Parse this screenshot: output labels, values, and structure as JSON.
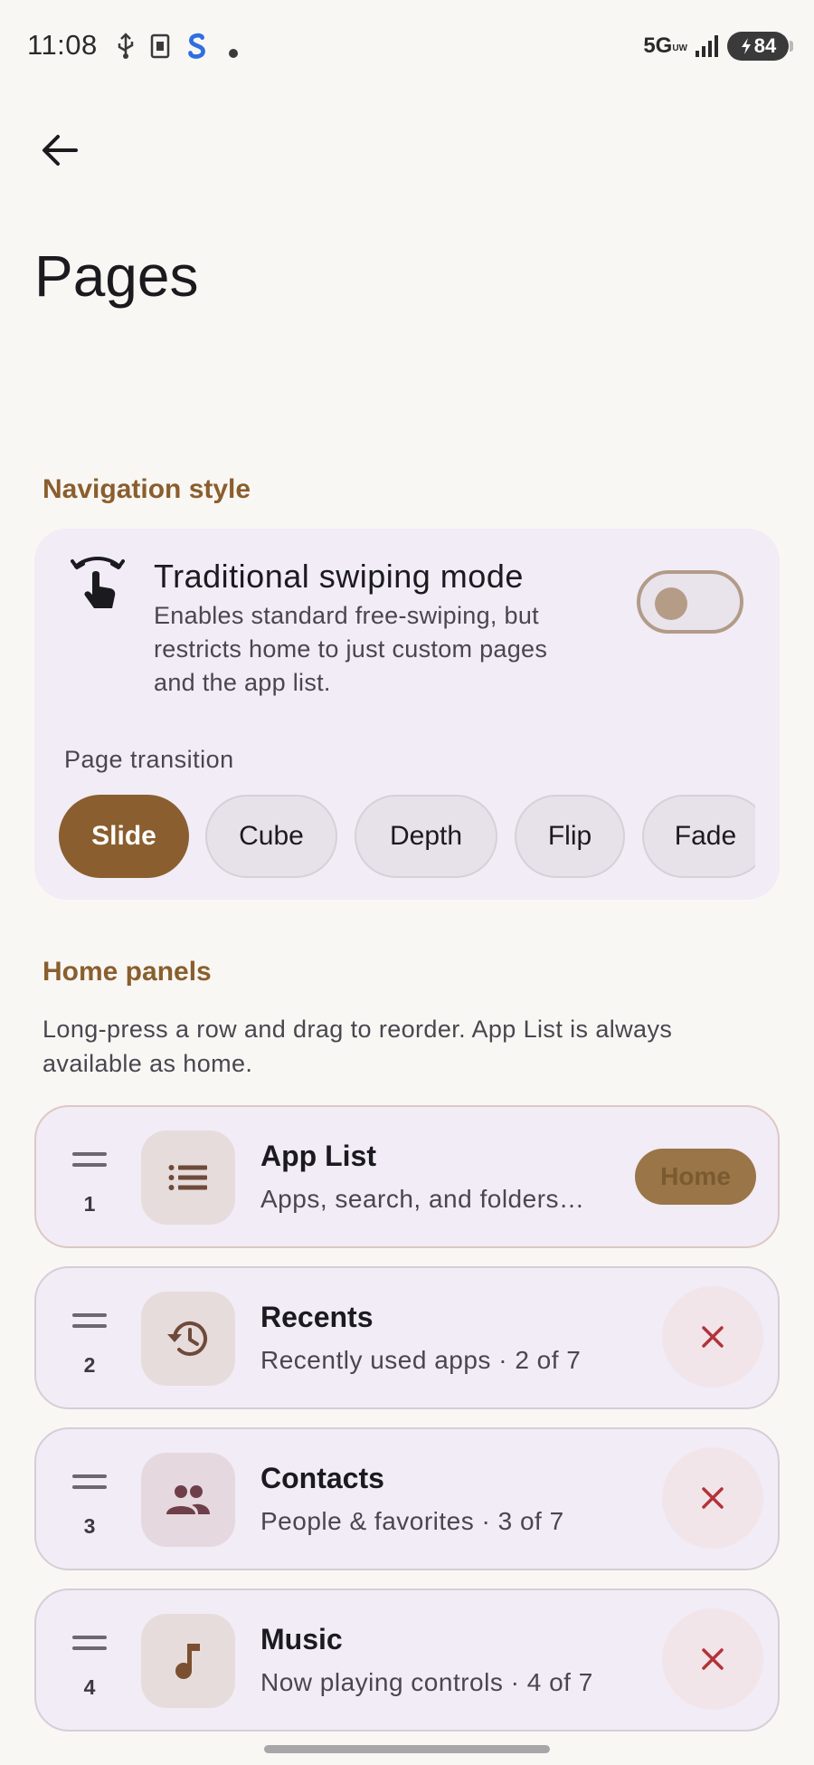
{
  "status_bar": {
    "time": "11:08",
    "network": "5G",
    "network_sub": "UW",
    "battery": "84"
  },
  "header": {
    "title": "Pages"
  },
  "navigation": {
    "section_label": "Navigation style",
    "swipe_title": "Traditional swiping mode",
    "swipe_description": "Enables standard free-swiping, but restricts home to just custom pages and the app list.",
    "toggle_on": false,
    "transition_label": "Page transition",
    "transitions": [
      {
        "label": "Slide",
        "selected": true
      },
      {
        "label": "Cube",
        "selected": false
      },
      {
        "label": "Depth",
        "selected": false
      },
      {
        "label": "Flip",
        "selected": false
      },
      {
        "label": "Fade",
        "selected": false
      }
    ]
  },
  "home_panels": {
    "section_label": "Home panels",
    "hint": "Long-press a row and drag to reorder. App List is always available as home.",
    "rows": [
      {
        "number": "1",
        "title": "App List",
        "subtitle": "Apps, search, and folders…",
        "icon": "list-icon",
        "action": "Home"
      },
      {
        "number": "2",
        "title": "Recents",
        "subtitle": "Recently used apps · 2 of 7",
        "icon": "history-icon",
        "action": "remove"
      },
      {
        "number": "3",
        "title": "Contacts",
        "subtitle": "People & favorites · 3 of 7",
        "icon": "people-icon",
        "action": "remove"
      },
      {
        "number": "4",
        "title": "Music",
        "subtitle": "Now playing controls · 4 of 7",
        "icon": "music-note-icon",
        "action": "remove"
      }
    ]
  },
  "colors": {
    "accent": "#8a5e2e",
    "card_background": "#f1ecf6",
    "page_background": "#f9f7f4",
    "remove_icon": "#b3333a"
  }
}
